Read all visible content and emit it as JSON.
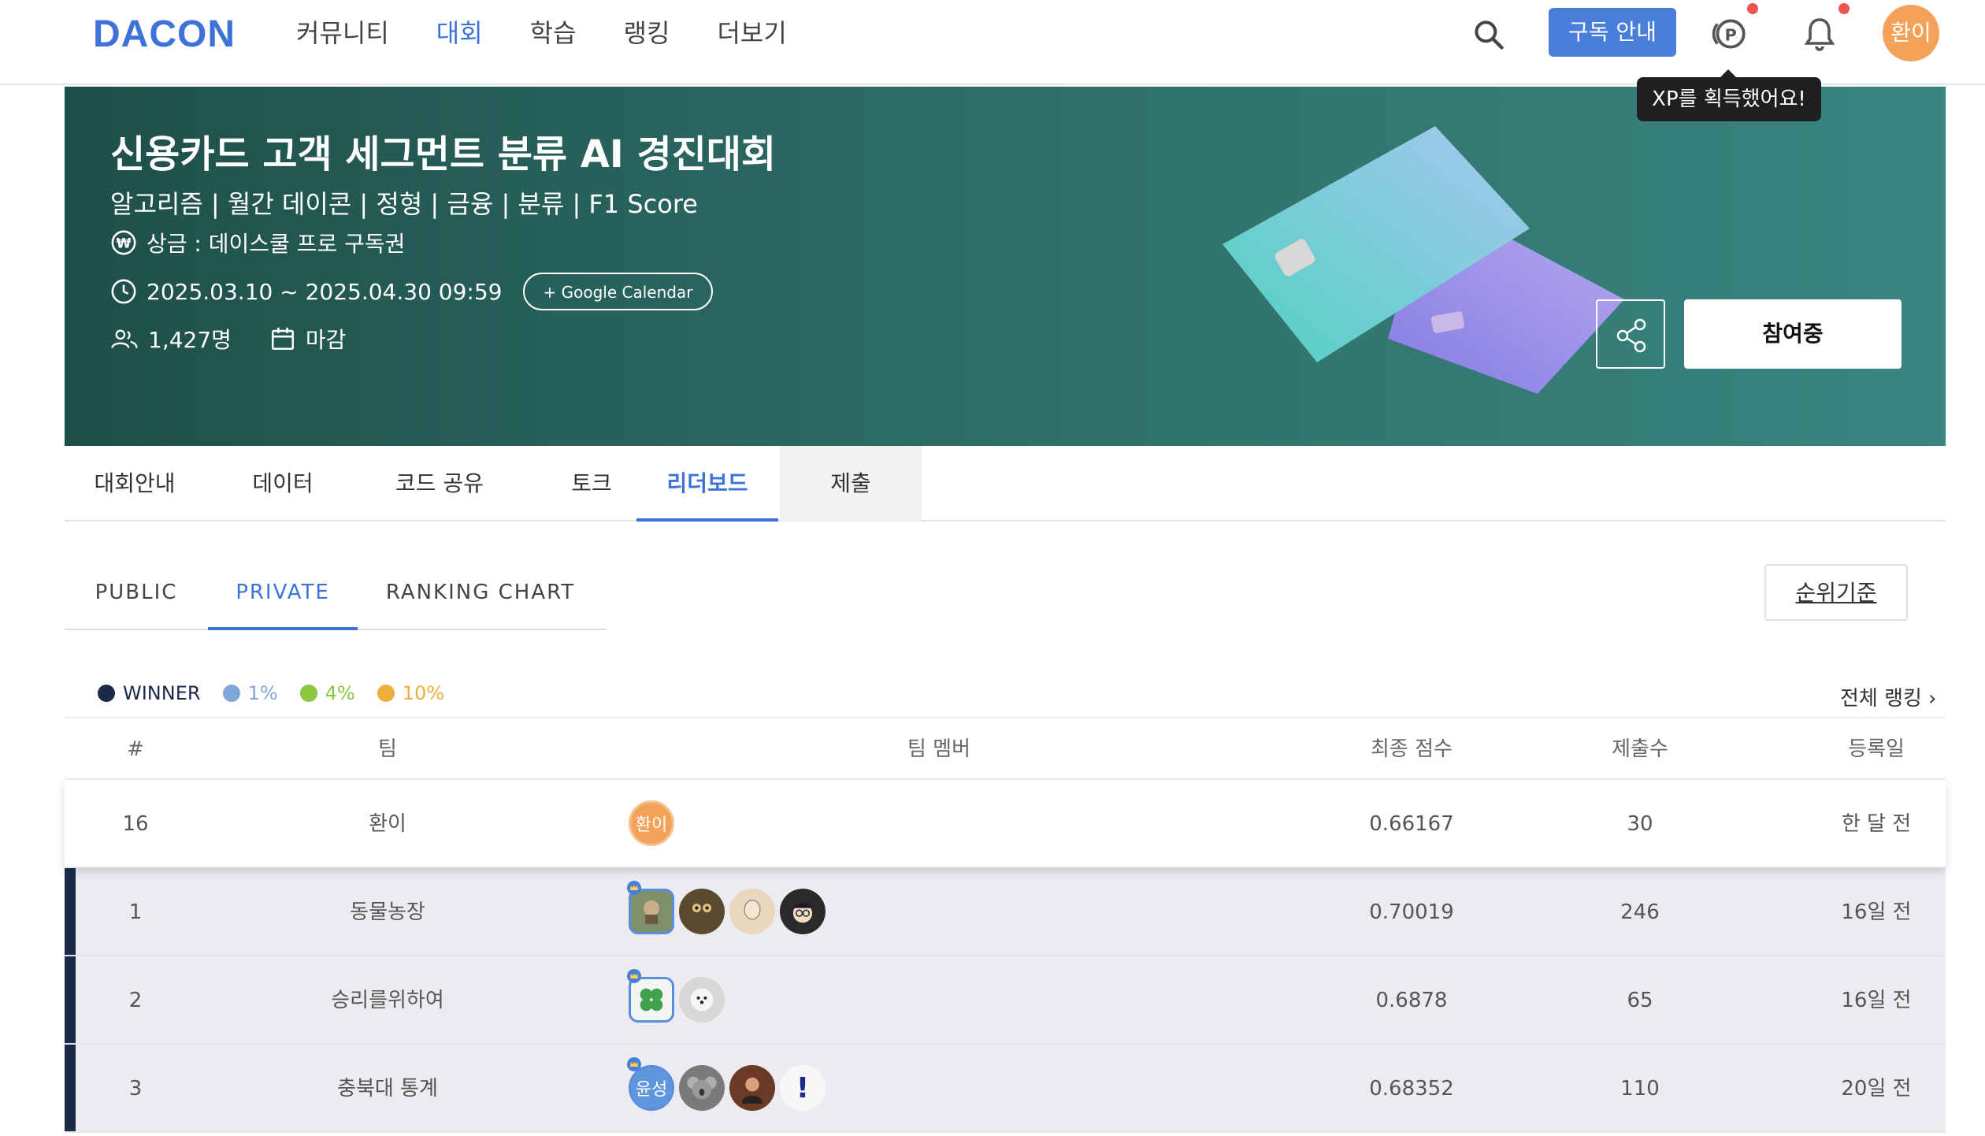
{
  "header": {
    "logo": "DACON",
    "nav": [
      "커뮤니티",
      "대회",
      "학습",
      "랭킹",
      "더보기"
    ],
    "active_nav": "대회",
    "subscribe_label": "구독 안내",
    "avatar_text": "환이",
    "tooltip": "XP를 획득했어요!"
  },
  "banner": {
    "title": "신용카드 고객 세그먼트 분류 AI 경진대회",
    "tags": "알고리즘 | 월간 데이콘 | 정형 | 금융 | 분류 | F1 Score",
    "prize": "상금 : 데이스쿨 프로 구독권",
    "period": "2025.03.10 ~ 2025.04.30 09:59",
    "calendar_label": "+ Google Calendar",
    "participants": "1,427명",
    "status": "마감",
    "join_label": "참여중"
  },
  "tabs": [
    "대회안내",
    "데이터",
    "코드 공유",
    "토크",
    "리더보드",
    "제출"
  ],
  "active_tab": "리더보드",
  "subtabs": [
    "PUBLIC",
    "PRIVATE",
    "RANKING CHART"
  ],
  "active_subtab": "PRIVATE",
  "rank_criteria_label": "순위기준",
  "legend": [
    {
      "label": "WINNER",
      "color": "#1c2a4a"
    },
    {
      "label": "1%",
      "color": "#7ea6d8"
    },
    {
      "label": "4%",
      "color": "#8cc63f"
    },
    {
      "label": "10%",
      "color": "#f0ad3a"
    }
  ],
  "full_ranking_label": "전체 랭킹",
  "table": {
    "headers": [
      "#",
      "팀",
      "팀 멤버",
      "최종 점수",
      "제출수",
      "등록일"
    ],
    "rows": [
      {
        "rank": "16",
        "team": "환이",
        "score": "0.66167",
        "submissions": "30",
        "date": "한 달 전"
      },
      {
        "rank": "1",
        "team": "동물농장",
        "score": "0.70019",
        "submissions": "246",
        "date": "16일 전"
      },
      {
        "rank": "2",
        "team": "승리를위하여",
        "score": "0.6878",
        "submissions": "65",
        "date": "16일 전"
      },
      {
        "rank": "3",
        "team": "충북대 통계",
        "score": "0.68352",
        "submissions": "110",
        "date": "20일 전"
      }
    ],
    "member_texts": {
      "me": "환이",
      "r3_leader": "윤성",
      "r3_last": "!"
    }
  }
}
